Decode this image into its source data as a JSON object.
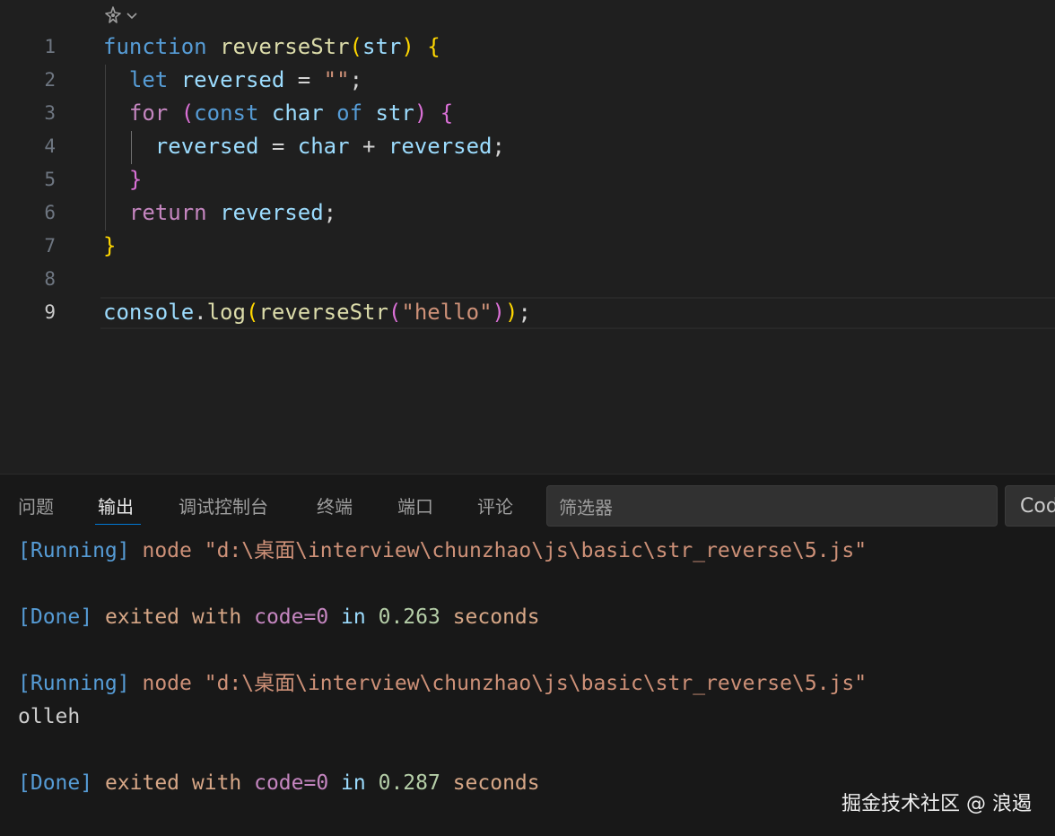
{
  "editor": {
    "codelens": {
      "icon": "copilot-sparkle-icon",
      "chevron": "chevron-down-icon"
    },
    "line_numbers": [
      "1",
      "2",
      "3",
      "4",
      "5",
      "6",
      "7",
      "8",
      "9"
    ],
    "lines": [
      [
        {
          "t": "function",
          "c": "kw"
        },
        {
          "t": " ",
          "c": "op"
        },
        {
          "t": "reverseStr",
          "c": "fn"
        },
        {
          "t": "(",
          "c": "b1"
        },
        {
          "t": "str",
          "c": "var"
        },
        {
          "t": ")",
          "c": "b1"
        },
        {
          "t": " ",
          "c": "op"
        },
        {
          "t": "{",
          "c": "b1"
        }
      ],
      [
        {
          "t": "  ",
          "c": "op"
        },
        {
          "t": "let",
          "c": "kw"
        },
        {
          "t": " ",
          "c": "op"
        },
        {
          "t": "reversed",
          "c": "var"
        },
        {
          "t": " = ",
          "c": "op"
        },
        {
          "t": "\"\"",
          "c": "str"
        },
        {
          "t": ";",
          "c": "op"
        }
      ],
      [
        {
          "t": "  ",
          "c": "op"
        },
        {
          "t": "for",
          "c": "ctrl"
        },
        {
          "t": " ",
          "c": "op"
        },
        {
          "t": "(",
          "c": "b2"
        },
        {
          "t": "const",
          "c": "kw"
        },
        {
          "t": " ",
          "c": "op"
        },
        {
          "t": "char",
          "c": "var"
        },
        {
          "t": " ",
          "c": "op"
        },
        {
          "t": "of",
          "c": "kw"
        },
        {
          "t": " ",
          "c": "op"
        },
        {
          "t": "str",
          "c": "var"
        },
        {
          "t": ")",
          "c": "b2"
        },
        {
          "t": " ",
          "c": "op"
        },
        {
          "t": "{",
          "c": "b2"
        }
      ],
      [
        {
          "t": "    ",
          "c": "op"
        },
        {
          "t": "reversed",
          "c": "var"
        },
        {
          "t": " = ",
          "c": "op"
        },
        {
          "t": "char",
          "c": "var"
        },
        {
          "t": " + ",
          "c": "op"
        },
        {
          "t": "reversed",
          "c": "var"
        },
        {
          "t": ";",
          "c": "op"
        }
      ],
      [
        {
          "t": "  ",
          "c": "op"
        },
        {
          "t": "}",
          "c": "b2"
        }
      ],
      [
        {
          "t": "  ",
          "c": "op"
        },
        {
          "t": "return",
          "c": "ctrl"
        },
        {
          "t": " ",
          "c": "op"
        },
        {
          "t": "reversed",
          "c": "var"
        },
        {
          "t": ";",
          "c": "op"
        }
      ],
      [
        {
          "t": "}",
          "c": "b1"
        }
      ],
      [],
      [
        {
          "t": "console",
          "c": "var"
        },
        {
          "t": ".",
          "c": "op"
        },
        {
          "t": "log",
          "c": "fn"
        },
        {
          "t": "(",
          "c": "b1"
        },
        {
          "t": "reverseStr",
          "c": "fn"
        },
        {
          "t": "(",
          "c": "b2"
        },
        {
          "t": "\"hello\"",
          "c": "str"
        },
        {
          "t": ")",
          "c": "b2"
        },
        {
          "t": ")",
          "c": "b1"
        },
        {
          "t": ";",
          "c": "op"
        }
      ]
    ]
  },
  "panel": {
    "tabs": [
      "问题",
      "输出",
      "调试控制台",
      "终端",
      "端口",
      "评论"
    ],
    "active_tab": "输出",
    "filter_placeholder": "筛选器",
    "channel_select": "Code"
  },
  "output": [
    [
      {
        "t": "[Running]",
        "c": "o-tag"
      },
      {
        "t": " node ",
        "c": "o-node"
      },
      {
        "t": "\"d:\\桌面\\interview\\chunzhao\\js\\basic\\str_reverse\\5.js\"",
        "c": "o-path"
      }
    ],
    [],
    [
      {
        "t": "[Done]",
        "c": "o-done"
      },
      {
        "t": " exited with ",
        "c": "o-text"
      },
      {
        "t": "code=0",
        "c": "o-code"
      },
      {
        "t": " in ",
        "c": "o-in"
      },
      {
        "t": "0.263",
        "c": "o-num"
      },
      {
        "t": " seconds",
        "c": "o-text"
      }
    ],
    [],
    [
      {
        "t": "[Running]",
        "c": "o-tag"
      },
      {
        "t": " node ",
        "c": "o-node"
      },
      {
        "t": "\"d:\\桌面\\interview\\chunzhao\\js\\basic\\str_reverse\\5.js\"",
        "c": "o-path"
      }
    ],
    [
      {
        "t": "olleh",
        "c": "o-plain"
      }
    ],
    [],
    [
      {
        "t": "[Done]",
        "c": "o-done"
      },
      {
        "t": " exited with ",
        "c": "o-text"
      },
      {
        "t": "code=0",
        "c": "o-code"
      },
      {
        "t": " in ",
        "c": "o-in"
      },
      {
        "t": "0.287",
        "c": "o-num"
      },
      {
        "t": " seconds",
        "c": "o-text"
      }
    ]
  ],
  "watermark": "掘金技术社区 @ 浪遏"
}
